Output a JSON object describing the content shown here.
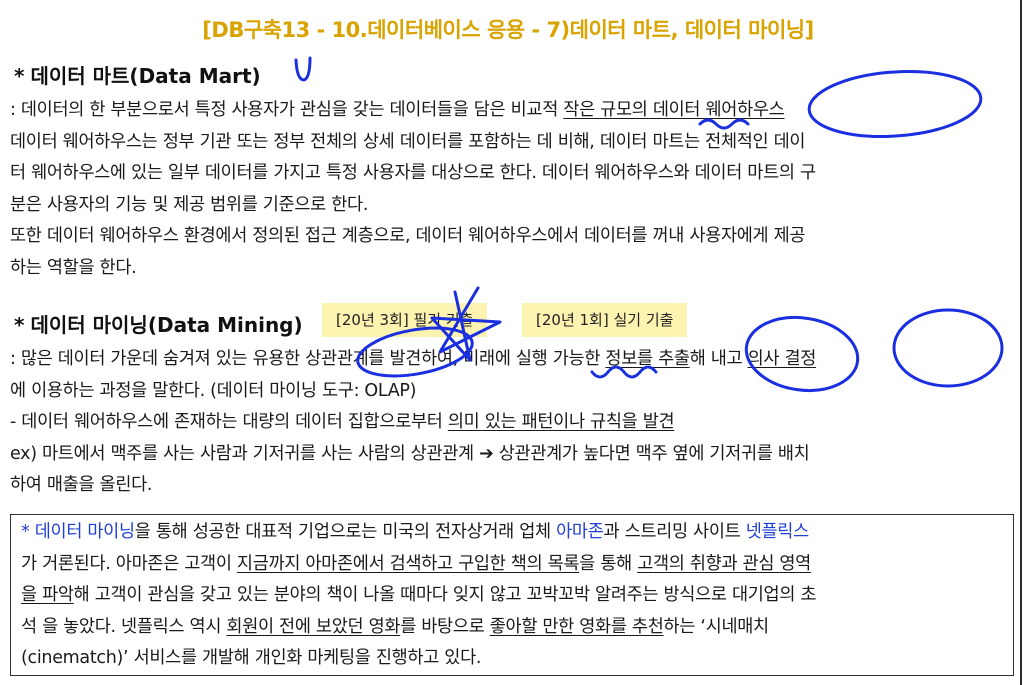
{
  "title": "[DB구축13 - 10.데이터베이스 응용 - 7)데이터 마트, 데이터 마이닝]",
  "section1": {
    "star": "*",
    "heading": "데이터 마트(Data Mart)",
    "l1a": ": 데이터의 한 부분으로서 특정 사용자가 관심을 갖는 데이터들을 담은 비교적 ",
    "l1u": "작은 규모의 데이터 웨어하우스",
    "l2": "데이터 웨어하우스는 정부 기관 또는 정부 전체의 상세 데이터를 포함하는 데 비해, 데이터 마트는 전체적인 데이",
    "l3": "터 웨어하우스에 있는 일부 데이터를 가지고 특정 사용자를 대상으로 한다. 데이터 웨어하우스와 데이터 마트의 구",
    "l4": "분은 사용자의 기능 및 제공 범위를 기준으로 한다.",
    "l5": "또한 데이터 웨어하우스 환경에서 정의된 접근 계층으로, 데이터 웨어하우스에서 데이터를 꺼내 사용자에게 제공",
    "l6": "하는 역할을 한다."
  },
  "section2": {
    "star": "*",
    "heading": "데이터 마이닝(Data Mining)",
    "tag1": "[20년 3회] 필기 기출",
    "tag2": "[20년 1회] 실기 기출",
    "l1a": ": 많은 데이터 가운데 숨겨져 있는 유용한 상관관계를 발견하여, 미래에 실행 가능한 ",
    "l1u1": "정보를 추출",
    "l1b": "해 내고 ",
    "l1u2": "의사 결정",
    "l2": "에 이용하는 과정을 말한다. (데이터 마이닝 도구: OLAP)",
    "l3a": "- 데이터 웨어하우스에 존재하는 대량의 데이터 집합으로부터 ",
    "l3u": "의미 있는 패턴이나 규칙을 발견",
    "l4": "ex) 마트에서 맥주를 사는 사람과 기저귀를 사는 사람의 상관관계 ➔ 상관관계가 높다면 맥주 옆에 기저귀를 배치",
    "l5": "하여 매출을 올린다."
  },
  "box": {
    "b1a": "* 데이터 마이닝",
    "b1b": "을 통해 성공한 대표적 기업으로는 미국의 전자상거래 업체 ",
    "b1c": "아마존",
    "b1d": "과 스트리밍 사이트 ",
    "b1e": "넷플릭스",
    "b2a": "가 거론된다. 아마존은 고객이 ",
    "b2u1": "지금까지 아마존에서 검색하고 구입한 책의 목록",
    "b2b": "을 통해 ",
    "b2u2": "고객의 취향과 관심 영역",
    "b3u": "을 파악",
    "b3b": "해 고객이 관심을 갖고 있는 분야의 책이 나올 때마다 잊지 않고 꼬박꼬박 알려주는 방식으로 대기업의 초",
    "b4a": "석 을 놓았다. 넷플릭스 역시 ",
    "b4u1": "회원이 전에 보았던 영화",
    "b4b": "를 바탕으로 ",
    "b4u2": "좋아할 만한 영화를 추천",
    "b4c": "하는 ‘시네매치",
    "b5": "(cinematch)’ 서비스를 개발해 개인화 마케팅을 진행하고 있다."
  },
  "colors": {
    "title": "#d9a300",
    "highlight": "#1f3fd6",
    "tag_bg": "#fdf3b0",
    "ink": "#1a2fe0"
  }
}
